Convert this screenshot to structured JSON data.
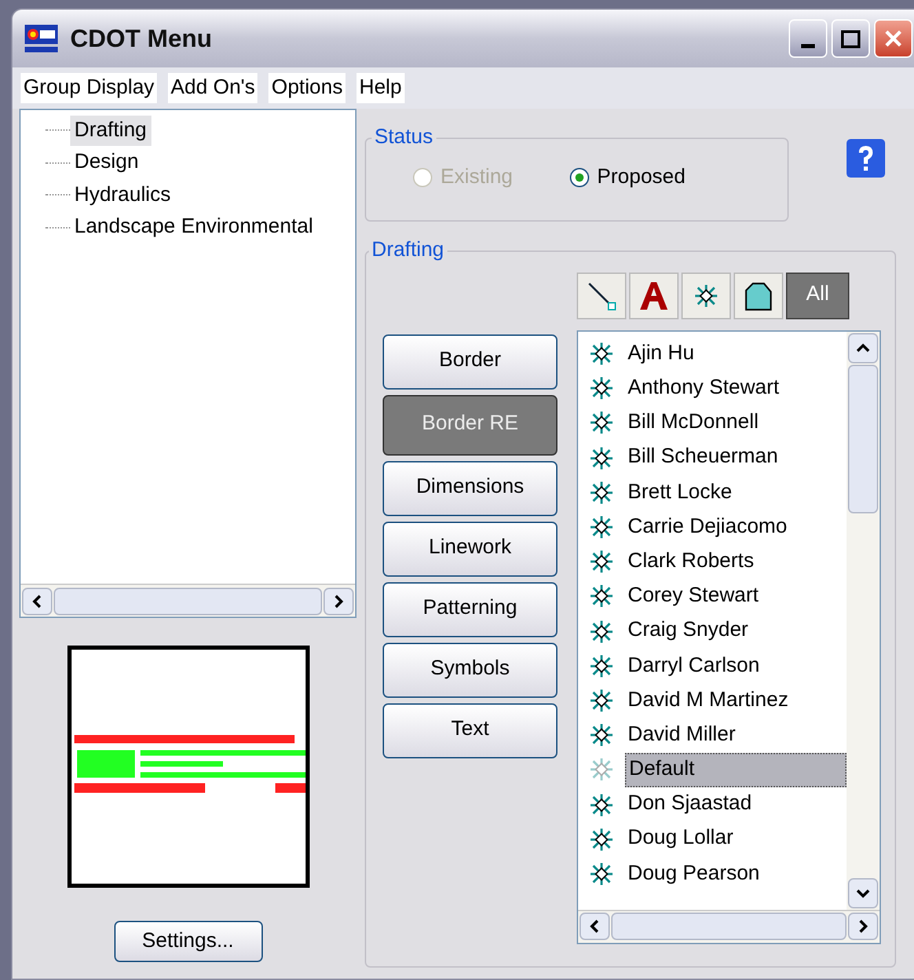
{
  "window": {
    "title": "CDOT Menu"
  },
  "menu": [
    "Group Display",
    "Add On's",
    "Options",
    "Help"
  ],
  "tree": [
    {
      "label": "Drafting",
      "selected": true
    },
    {
      "label": "Design",
      "selected": false
    },
    {
      "label": "Hydraulics",
      "selected": false
    },
    {
      "label": "Landscape Environmental",
      "selected": false
    }
  ],
  "settings_button": "Settings...",
  "status": {
    "title": "Status",
    "options": [
      {
        "label": "Existing",
        "selected": false,
        "disabled": true
      },
      {
        "label": "Proposed",
        "selected": true,
        "disabled": false
      }
    ]
  },
  "drafting": {
    "title": "Drafting",
    "filters": [
      {
        "kind": "line",
        "selected": false
      },
      {
        "kind": "text",
        "selected": false
      },
      {
        "kind": "cell",
        "selected": false
      },
      {
        "kind": "pattern",
        "selected": false
      },
      {
        "kind": "all",
        "label": "All",
        "selected": true
      }
    ],
    "groups": [
      {
        "label": "Border",
        "selected": false
      },
      {
        "label": "Border RE",
        "selected": true
      },
      {
        "label": "Dimensions",
        "selected": false
      },
      {
        "label": "Linework",
        "selected": false
      },
      {
        "label": "Patterning",
        "selected": false
      },
      {
        "label": "Symbols",
        "selected": false
      },
      {
        "label": "Text",
        "selected": false
      }
    ],
    "items": [
      {
        "label": "Ajin Hu",
        "selected": false
      },
      {
        "label": "Anthony Stewart",
        "selected": false
      },
      {
        "label": "Bill McDonnell",
        "selected": false
      },
      {
        "label": "Bill Scheuerman",
        "selected": false
      },
      {
        "label": "Brett Locke",
        "selected": false
      },
      {
        "label": "Carrie Dejiacomo",
        "selected": false
      },
      {
        "label": "Clark Roberts",
        "selected": false
      },
      {
        "label": "Corey Stewart",
        "selected": false
      },
      {
        "label": "Craig Snyder",
        "selected": false
      },
      {
        "label": "Darryl Carlson",
        "selected": false
      },
      {
        "label": "David M Martinez",
        "selected": false
      },
      {
        "label": "David Miller",
        "selected": false
      },
      {
        "label": "Default",
        "selected": true
      },
      {
        "label": "Don Sjaastad",
        "selected": false
      },
      {
        "label": "Doug Lollar",
        "selected": false
      },
      {
        "label": "Doug Pearson",
        "selected": false
      }
    ]
  }
}
